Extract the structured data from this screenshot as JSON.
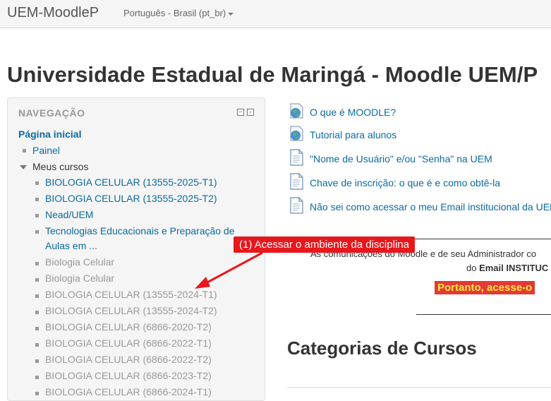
{
  "navbar": {
    "brand": "UEM-MoodleP",
    "language": "Português - Brasil (pt_br)"
  },
  "site_title": "Universidade Estadual de Maringá - Moodle UEM/P",
  "navigation": {
    "title": "NAVEGAÇÃO",
    "home": "Página inicial",
    "painel": "Painel",
    "meus_cursos": "Meus cursos",
    "courses": [
      "BIOLOGIA CELULAR (13555-2025-T1)",
      "BIOLOGIA CELULAR (13555-2025-T2)",
      "Nead/UEM",
      "Tecnologias Educacionais e Preparação de Aulas em ...",
      "Biologia Celular",
      "Biologia Celular",
      "BIOLOGIA CELULAR (13555-2024-T1)",
      "BIOLOGIA CELULAR (13555-2024-T2)",
      "BIOLOGIA CELULAR (6866-2020-T2)",
      "BIOLOGIA CELULAR (6866-2022-T1)",
      "BIOLOGIA CELULAR (6866-2022-T2)",
      "BIOLOGIA CELULAR (6866-2023-T2)",
      "BIOLOGIA CELULAR (6866-2024-T1)"
    ]
  },
  "resources": [
    {
      "label": "O que é MOODLE?",
      "icon": "globe-icon"
    },
    {
      "label": "Tutorial para alunos",
      "icon": "globe-icon"
    },
    {
      "label": "\"Nome de Usuário\" e/ou \"Senha\" na UEM",
      "icon": "document-icon"
    },
    {
      "label": "Chave de inscrição: o que é e como obtê-la",
      "icon": "document-icon"
    },
    {
      "label": "Não sei como acessar o meu Email institucional da UEM",
      "icon": "document-icon"
    }
  ],
  "notice": {
    "line1": "As comunicações do Moodle e de seu Administrador co",
    "line2_prefix": "do ",
    "line2_bold": "Email INSTITUC",
    "portanto": "Portanto, acesse-o"
  },
  "categories_title": "Categorias de Cursos",
  "annotation": {
    "label": "(1) Acessar o ambiente da disciplina",
    "color": "#e8171c"
  },
  "colors": {
    "link": "#0b6a9e",
    "muted": "#999999",
    "highlight_bg": "#e53935",
    "highlight_text": "#ffeb3b"
  }
}
